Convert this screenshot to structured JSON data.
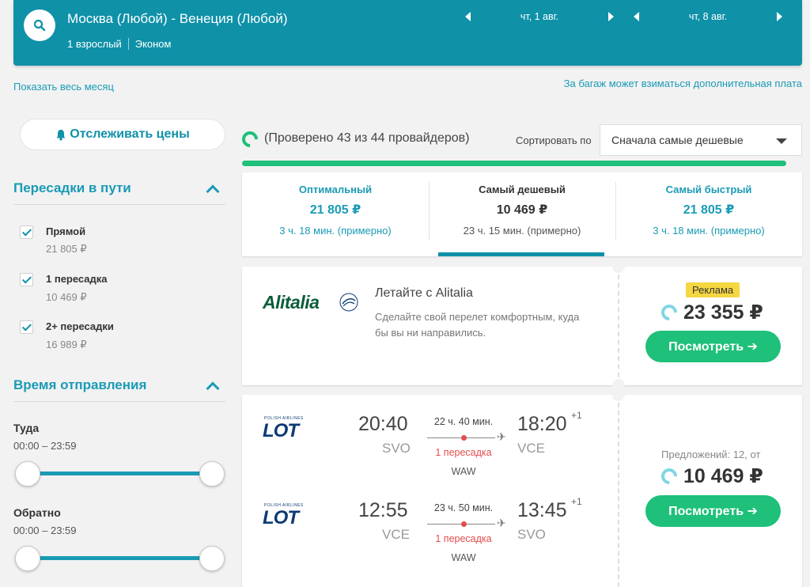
{
  "header": {
    "route": "Москва (Любой) - Венеция (Любой)",
    "passengers": "1 взрослый",
    "cabin": "Эконом",
    "depart_date": "чт, 1 авг.",
    "return_date": "чт, 8 авг."
  },
  "links": {
    "show_month": "Показать весь месяц",
    "baggage_note": "За багаж может взиматься дополнительная плата"
  },
  "sidebar": {
    "track_prices": "Отслеживать цены",
    "stops_title": "Пересадки в пути",
    "stops": [
      {
        "label": "Прямой",
        "price": "21 805 ₽",
        "checked": true
      },
      {
        "label": "1 пересадка",
        "price": "10 469 ₽",
        "checked": true
      },
      {
        "label": "2+ пересадки",
        "price": "16 989 ₽",
        "checked": true
      }
    ],
    "time_title": "Время отправления",
    "outbound": {
      "label": "Туда",
      "range": "00:00 – 23:59"
    },
    "inbound": {
      "label": "Обратно",
      "range": "00:00 – 23:59"
    }
  },
  "status": {
    "checked": "(Проверено 43 из 44 провайдеров)",
    "sort_label": "Сортировать по",
    "sort_value": "Сначала самые дешевые",
    "progress_fraction": 0.977
  },
  "tabs": [
    {
      "title": "Оптимальный",
      "price": "21 805 ₽",
      "duration": "3 ч. 18 мин. (примерно)"
    },
    {
      "title": "Самый дешевый",
      "price": "10 469 ₽",
      "duration": "23 ч. 15 мин. (примерно)"
    },
    {
      "title": "Самый быстрый",
      "price": "21 805 ₽",
      "duration": "3 ч. 18 мин. (примерно)"
    }
  ],
  "ad": {
    "logo_text": "Alitalia",
    "title": "Летайте с Alitalia",
    "desc1": "Сделайте свой перелет комфортным, куда",
    "desc2": "бы вы ни направились.",
    "badge": "Реклама",
    "price": "23 355 ₽",
    "button": "Посмотреть ➔"
  },
  "result": {
    "airline_logo": "LOT",
    "airline_tag": "POLISH AIRLINES",
    "offers": "Предложений: 12, от",
    "price": "10 469 ₽",
    "button": "Посмотреть ➔",
    "legs": [
      {
        "dep_time": "20:40",
        "dep_code": "SVO",
        "duration": "22 ч. 40 мин.",
        "arr_time": "18:20",
        "arr_code": "VCE",
        "plus_day": "+1",
        "stops": "1 пересадка",
        "via": "WAW"
      },
      {
        "dep_time": "12:55",
        "dep_code": "VCE",
        "duration": "23 ч. 50 мин.",
        "arr_time": "13:45",
        "arr_code": "SVO",
        "plus_day": "+1",
        "stops": "1 пересадка",
        "via": "WAW"
      }
    ]
  },
  "colors": {
    "brand": "#0f91a8",
    "green": "#1ec07a",
    "accent_text": "#1a9bb5",
    "stop_red": "#e34c4c"
  }
}
